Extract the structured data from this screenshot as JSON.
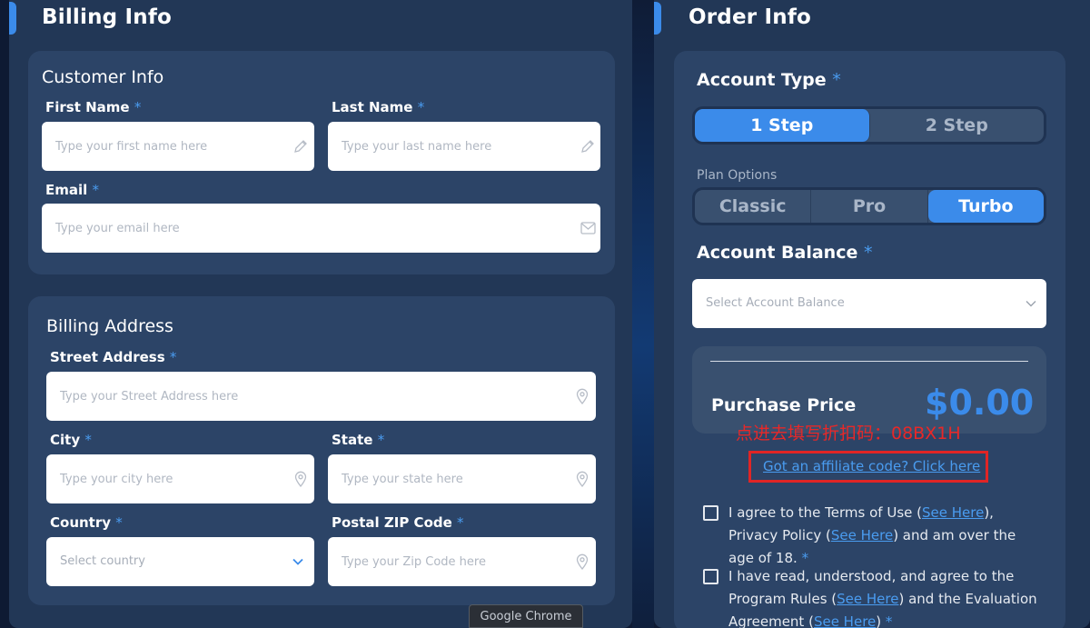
{
  "billing": {
    "title": "Billing Info",
    "customer": {
      "title": "Customer Info",
      "first_name_label": "First Name",
      "first_name_placeholder": "Type your first name here",
      "last_name_label": "Last Name",
      "last_name_placeholder": "Type your last name here",
      "email_label": "Email",
      "email_placeholder": "Type your email here"
    },
    "address": {
      "title": "Billing Address",
      "street_label": "Street Address",
      "street_placeholder": "Type your Street Address here",
      "city_label": "City",
      "city_placeholder": "Type your city here",
      "state_label": "State",
      "state_placeholder": "Type your state here",
      "country_label": "Country",
      "country_value": "Select country",
      "zip_label": "Postal ZIP Code",
      "zip_placeholder": "Type your Zip Code here"
    },
    "required_mark": "*"
  },
  "order": {
    "title": "Order Info",
    "account_type": {
      "label": "Account Type",
      "options": [
        "1 Step",
        "2 Step"
      ],
      "selected": "1 Step"
    },
    "plan_options": {
      "label": "Plan Options",
      "options": [
        "Classic",
        "Pro",
        "Turbo"
      ],
      "selected": "Turbo"
    },
    "balance": {
      "label": "Account Balance",
      "value": "Select Account Balance"
    },
    "purchase": {
      "label": "Purchase Price",
      "value": "$0.00"
    },
    "annotation": "点进去填写折扣码：08BX1H",
    "affiliate_link": "Got an affiliate code? Click here",
    "terms": {
      "part1": "I agree to the Terms of Use (",
      "link1": "See Here",
      "part2": "), Privacy Policy (",
      "link2": "See Here",
      "part3": ") and am over the age of 18.",
      "required": " *"
    },
    "rules": {
      "part1": "I have read, understood, and agree to the Program Rules (",
      "link1": "See Here",
      "part2": ") and the Evaluation Agreement (",
      "link2": "See Here",
      "part3": ")",
      "required": " *"
    }
  },
  "browser": {
    "tooltip": "Google Chrome"
  },
  "colors": {
    "accent": "#3b8bea",
    "panel": "#223756",
    "card": "#2c4467",
    "annotation_red": "#e02525"
  }
}
